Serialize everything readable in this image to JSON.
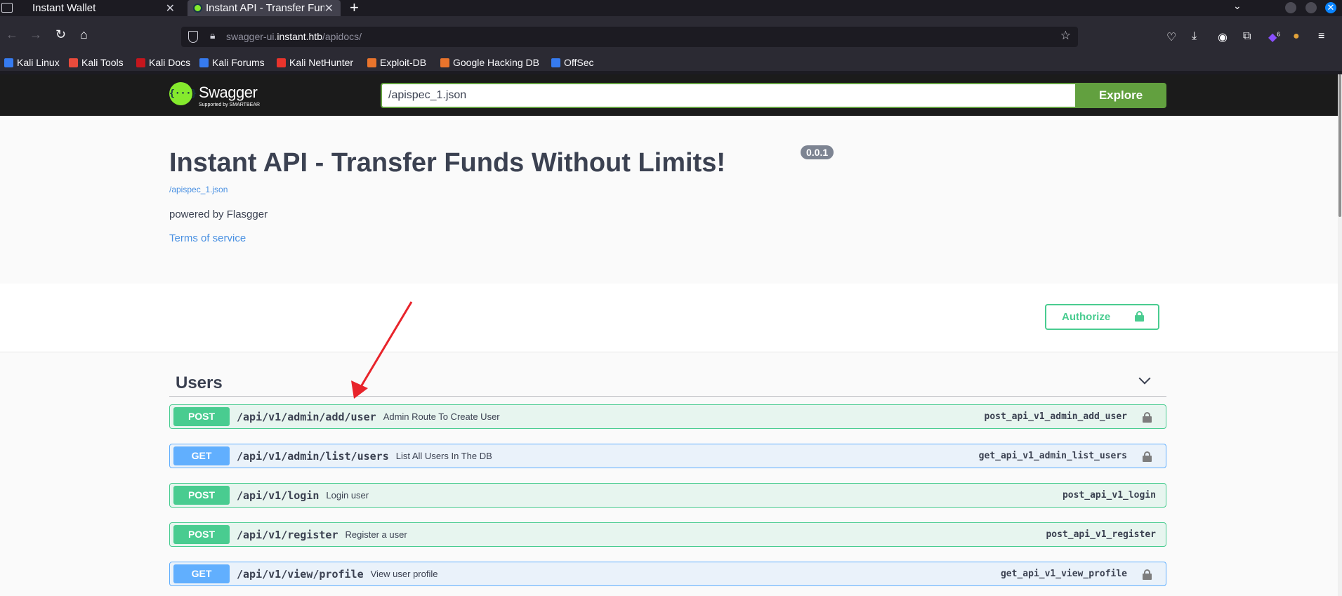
{
  "browser": {
    "tabs": [
      {
        "title": "Instant Wallet"
      },
      {
        "title": "Instant API - Transfer Funds Without Limits!"
      }
    ],
    "url_prefix": "swagger-ui.",
    "url_host": "instant.htb",
    "url_path": "/apidocs/",
    "extension_badge": "6",
    "bookmarks": [
      {
        "label": "Kali Linux",
        "icon_color": "#367bf0"
      },
      {
        "label": "Kali Tools",
        "icon_color": "#e94b3c"
      },
      {
        "label": "Kali Docs",
        "icon_color": "#c5161d"
      },
      {
        "label": "Kali Forums",
        "icon_color": "#367bf0"
      },
      {
        "label": "Kali NetHunter",
        "icon_color": "#e9342c"
      },
      {
        "label": "Exploit-DB",
        "icon_color": "#e9742c"
      },
      {
        "label": "Google Hacking DB",
        "icon_color": "#e9742c"
      },
      {
        "label": "OffSec",
        "icon_color": "#367bf0"
      }
    ]
  },
  "swagger": {
    "logo_text": "Swagger",
    "logo_sub": "Supported by SMARTBEAR",
    "spec_url": "/apispec_1.json",
    "explore_label": "Explore"
  },
  "info": {
    "title": "Instant API - Transfer Funds Without Limits!",
    "version": "0.0.1",
    "spec_link": "/apispec_1.json",
    "powered": "powered by Flasgger",
    "terms": "Terms of service"
  },
  "authorize_label": "Authorize",
  "tag": {
    "name": "Users"
  },
  "operations": [
    {
      "method": "POST",
      "path": "/api/v1/admin/add/user",
      "summary": "Admin Route To Create User",
      "op_id": "post_api_v1_admin_add_user",
      "locked": true
    },
    {
      "method": "GET",
      "path": "/api/v1/admin/list/users",
      "summary": "List All Users In The DB",
      "op_id": "get_api_v1_admin_list_users",
      "locked": true
    },
    {
      "method": "POST",
      "path": "/api/v1/login",
      "summary": "Login user",
      "op_id": "post_api_v1_login",
      "locked": false
    },
    {
      "method": "POST",
      "path": "/api/v1/register",
      "summary": "Register a user",
      "op_id": "post_api_v1_register",
      "locked": false
    },
    {
      "method": "GET",
      "path": "/api/v1/view/profile",
      "summary": "View user profile",
      "op_id": "get_api_v1_view_profile",
      "locked": true
    }
  ],
  "colors": {
    "post": "#49cc90",
    "get": "#61affe",
    "swagger_green": "#62a03f",
    "annotation_arrow": "#e8242b"
  }
}
